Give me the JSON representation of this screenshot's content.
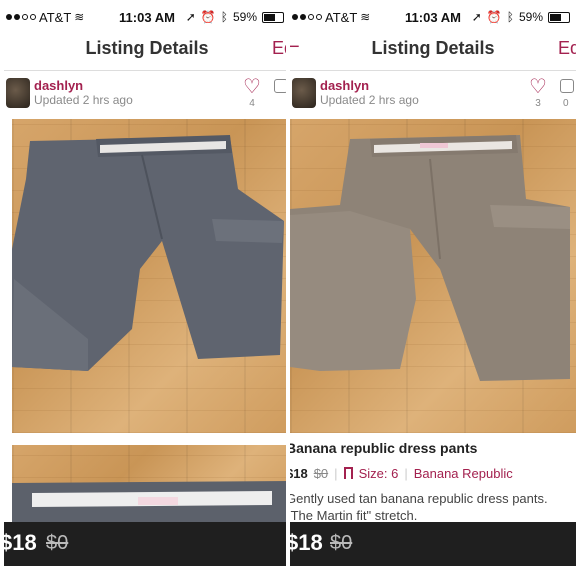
{
  "status": {
    "carrier": "AT&T",
    "time": "11:03 AM",
    "battery": "59%",
    "battery_level": 0.59
  },
  "nav": {
    "title": "Listing Details",
    "edit_label": "Ed",
    "back_glyph": "−"
  },
  "seller": {
    "username": "dashlyn",
    "updated": "Updated 2 hrs ago"
  },
  "left": {
    "likes": "4",
    "comments": "",
    "price_bar": {
      "price": "$18",
      "original": "$0"
    }
  },
  "right": {
    "likes": "3",
    "comments": "0",
    "listing": {
      "title": "Banana republic dress pants",
      "price": "$18",
      "original": "$0",
      "size_label": "Size: 6",
      "brand": "Banana Republic",
      "description": "Gently used tan banana republic dress pants. \"The Martin fit\" stretch."
    },
    "price_bar": {
      "price": "$18",
      "original": "$0"
    }
  },
  "icons": {
    "heart": "heart-icon",
    "comment": "comment-icon",
    "pants": "pants-icon",
    "wifi": "wifi-icon",
    "location": "location-arrow-icon",
    "alarm": "alarm-icon",
    "bluetooth": "bluetooth-icon"
  },
  "colors": {
    "accent": "#a3214f",
    "left_pants": "#5f646f",
    "right_pants": "#8e8377",
    "floor": "#d3a066",
    "price_bar": "#1f1f1f"
  }
}
